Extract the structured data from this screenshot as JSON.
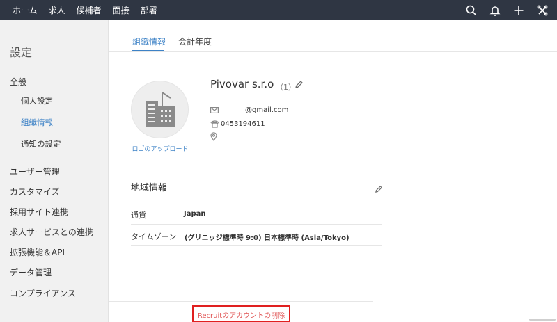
{
  "nav": {
    "items": [
      "ホーム",
      "求人",
      "候補者",
      "面接",
      "部署"
    ]
  },
  "top_icons": [
    "search-icon",
    "bell-icon",
    "plus-icon",
    "tools-icon"
  ],
  "sidebar": {
    "title": "設定",
    "general": "全般",
    "sub_items": [
      "個人設定",
      "組織情報",
      "通知の設定"
    ],
    "active_sub": "組織情報",
    "items": [
      "ユーザー管理",
      "カスタマイズ",
      "採用サイト連携",
      "求人サービスとの連携",
      "拡張機能＆API",
      "データ管理",
      "コンプライアンス"
    ]
  },
  "tabs": [
    "組織情報",
    "会計年度"
  ],
  "org": {
    "upload_label": "ロゴのアップロード",
    "name": "Pivovar s.r.o",
    "count": "（1）",
    "email": "@gmail.com",
    "phone": "0453194611"
  },
  "locale": {
    "title": "地域情報",
    "currency_label": "通貨",
    "currency_value": "Japan",
    "timezone_label": "タイムゾーン",
    "timezone_value": "(グリニッジ標準時 9:0) 日本標準時 (Asia/Tokyo)"
  },
  "footer": {
    "delete_link": "Recruitのアカウントの削除"
  },
  "colors": {
    "topbar": "#2f3643",
    "accent": "#3d82c6",
    "sidebar_bg": "#f1f1f1",
    "danger": "#e02020"
  }
}
